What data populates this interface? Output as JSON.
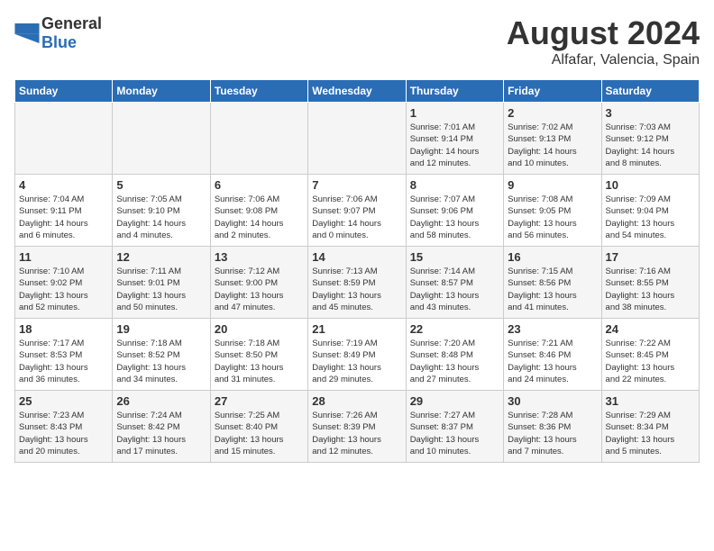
{
  "header": {
    "logo_general": "General",
    "logo_blue": "Blue",
    "month_year": "August 2024",
    "location": "Alfafar, Valencia, Spain"
  },
  "weekdays": [
    "Sunday",
    "Monday",
    "Tuesday",
    "Wednesday",
    "Thursday",
    "Friday",
    "Saturday"
  ],
  "weeks": [
    [
      {
        "day": "",
        "info": ""
      },
      {
        "day": "",
        "info": ""
      },
      {
        "day": "",
        "info": ""
      },
      {
        "day": "",
        "info": ""
      },
      {
        "day": "1",
        "info": "Sunrise: 7:01 AM\nSunset: 9:14 PM\nDaylight: 14 hours\nand 12 minutes."
      },
      {
        "day": "2",
        "info": "Sunrise: 7:02 AM\nSunset: 9:13 PM\nDaylight: 14 hours\nand 10 minutes."
      },
      {
        "day": "3",
        "info": "Sunrise: 7:03 AM\nSunset: 9:12 PM\nDaylight: 14 hours\nand 8 minutes."
      }
    ],
    [
      {
        "day": "4",
        "info": "Sunrise: 7:04 AM\nSunset: 9:11 PM\nDaylight: 14 hours\nand 6 minutes."
      },
      {
        "day": "5",
        "info": "Sunrise: 7:05 AM\nSunset: 9:10 PM\nDaylight: 14 hours\nand 4 minutes."
      },
      {
        "day": "6",
        "info": "Sunrise: 7:06 AM\nSunset: 9:08 PM\nDaylight: 14 hours\nand 2 minutes."
      },
      {
        "day": "7",
        "info": "Sunrise: 7:06 AM\nSunset: 9:07 PM\nDaylight: 14 hours\nand 0 minutes."
      },
      {
        "day": "8",
        "info": "Sunrise: 7:07 AM\nSunset: 9:06 PM\nDaylight: 13 hours\nand 58 minutes."
      },
      {
        "day": "9",
        "info": "Sunrise: 7:08 AM\nSunset: 9:05 PM\nDaylight: 13 hours\nand 56 minutes."
      },
      {
        "day": "10",
        "info": "Sunrise: 7:09 AM\nSunset: 9:04 PM\nDaylight: 13 hours\nand 54 minutes."
      }
    ],
    [
      {
        "day": "11",
        "info": "Sunrise: 7:10 AM\nSunset: 9:02 PM\nDaylight: 13 hours\nand 52 minutes."
      },
      {
        "day": "12",
        "info": "Sunrise: 7:11 AM\nSunset: 9:01 PM\nDaylight: 13 hours\nand 50 minutes."
      },
      {
        "day": "13",
        "info": "Sunrise: 7:12 AM\nSunset: 9:00 PM\nDaylight: 13 hours\nand 47 minutes."
      },
      {
        "day": "14",
        "info": "Sunrise: 7:13 AM\nSunset: 8:59 PM\nDaylight: 13 hours\nand 45 minutes."
      },
      {
        "day": "15",
        "info": "Sunrise: 7:14 AM\nSunset: 8:57 PM\nDaylight: 13 hours\nand 43 minutes."
      },
      {
        "day": "16",
        "info": "Sunrise: 7:15 AM\nSunset: 8:56 PM\nDaylight: 13 hours\nand 41 minutes."
      },
      {
        "day": "17",
        "info": "Sunrise: 7:16 AM\nSunset: 8:55 PM\nDaylight: 13 hours\nand 38 minutes."
      }
    ],
    [
      {
        "day": "18",
        "info": "Sunrise: 7:17 AM\nSunset: 8:53 PM\nDaylight: 13 hours\nand 36 minutes."
      },
      {
        "day": "19",
        "info": "Sunrise: 7:18 AM\nSunset: 8:52 PM\nDaylight: 13 hours\nand 34 minutes."
      },
      {
        "day": "20",
        "info": "Sunrise: 7:18 AM\nSunset: 8:50 PM\nDaylight: 13 hours\nand 31 minutes."
      },
      {
        "day": "21",
        "info": "Sunrise: 7:19 AM\nSunset: 8:49 PM\nDaylight: 13 hours\nand 29 minutes."
      },
      {
        "day": "22",
        "info": "Sunrise: 7:20 AM\nSunset: 8:48 PM\nDaylight: 13 hours\nand 27 minutes."
      },
      {
        "day": "23",
        "info": "Sunrise: 7:21 AM\nSunset: 8:46 PM\nDaylight: 13 hours\nand 24 minutes."
      },
      {
        "day": "24",
        "info": "Sunrise: 7:22 AM\nSunset: 8:45 PM\nDaylight: 13 hours\nand 22 minutes."
      }
    ],
    [
      {
        "day": "25",
        "info": "Sunrise: 7:23 AM\nSunset: 8:43 PM\nDaylight: 13 hours\nand 20 minutes."
      },
      {
        "day": "26",
        "info": "Sunrise: 7:24 AM\nSunset: 8:42 PM\nDaylight: 13 hours\nand 17 minutes."
      },
      {
        "day": "27",
        "info": "Sunrise: 7:25 AM\nSunset: 8:40 PM\nDaylight: 13 hours\nand 15 minutes."
      },
      {
        "day": "28",
        "info": "Sunrise: 7:26 AM\nSunset: 8:39 PM\nDaylight: 13 hours\nand 12 minutes."
      },
      {
        "day": "29",
        "info": "Sunrise: 7:27 AM\nSunset: 8:37 PM\nDaylight: 13 hours\nand 10 minutes."
      },
      {
        "day": "30",
        "info": "Sunrise: 7:28 AM\nSunset: 8:36 PM\nDaylight: 13 hours\nand 7 minutes."
      },
      {
        "day": "31",
        "info": "Sunrise: 7:29 AM\nSunset: 8:34 PM\nDaylight: 13 hours\nand 5 minutes."
      }
    ]
  ]
}
